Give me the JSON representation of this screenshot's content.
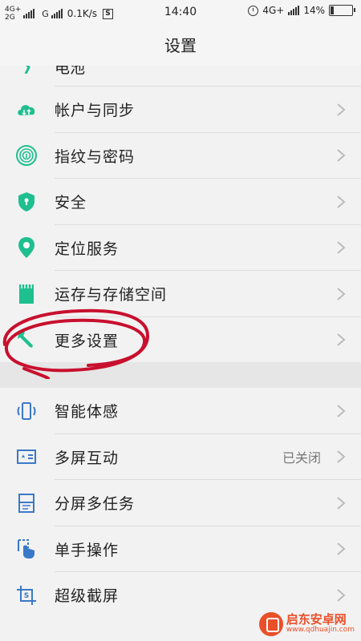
{
  "status_bar": {
    "signal1": "4G+",
    "signal2": "2G",
    "carrier2_type": "G",
    "speed": "0.1K/s",
    "screenshot_indicator": "S",
    "time": "14:40",
    "network": "4G+",
    "battery_percent": "14%",
    "battery_level": 0.14
  },
  "header": {
    "title": "设置"
  },
  "partial_item": {
    "label": "电池"
  },
  "group1": [
    {
      "label": "帐户与同步",
      "icon": "cloud-sync-icon"
    },
    {
      "label": "指纹与密码",
      "icon": "fingerprint-icon"
    },
    {
      "label": "安全",
      "icon": "shield-icon"
    },
    {
      "label": "定位服务",
      "icon": "location-pin-icon"
    },
    {
      "label": "运存与存储空间",
      "icon": "sd-card-icon"
    },
    {
      "label": "更多设置",
      "icon": "wrench-icon"
    }
  ],
  "group2": [
    {
      "label": "智能体感",
      "icon": "phone-motion-icon",
      "value": ""
    },
    {
      "label": "多屏互动",
      "icon": "multi-screen-icon",
      "value": "已关闭"
    },
    {
      "label": "分屏多任务",
      "icon": "split-screen-icon",
      "value": ""
    },
    {
      "label": "单手操作",
      "icon": "one-hand-icon",
      "value": ""
    },
    {
      "label": "超级截屏",
      "icon": "screenshot-icon",
      "value": ""
    }
  ],
  "colors": {
    "accent": "#1fbf8f",
    "blue_icon": "#3a79c9",
    "annotation": "#c8102e"
  },
  "watermark": {
    "title": "启东安卓网",
    "url": "www.qdhuajin.com"
  }
}
